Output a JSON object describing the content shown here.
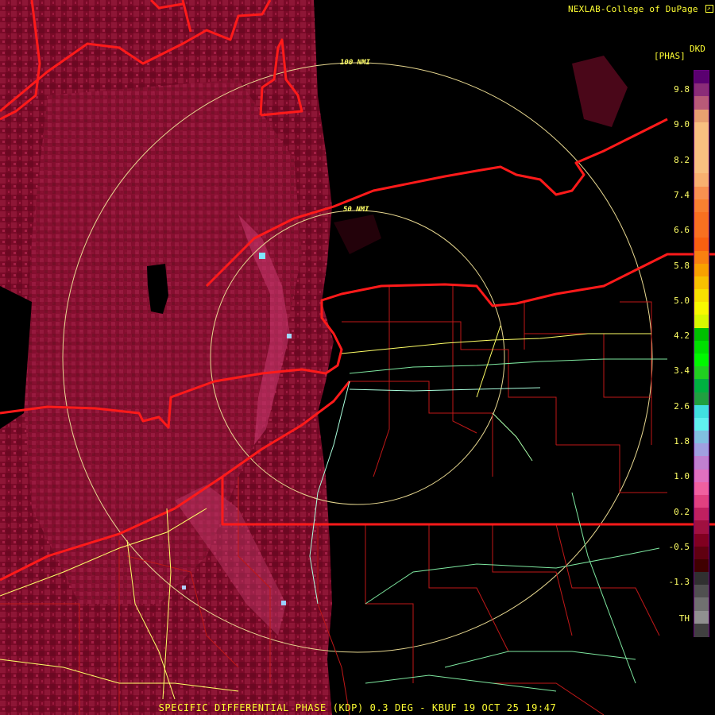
{
  "header": {
    "credit": "NEXLAB-College of DuPage",
    "credit_icon": "external-link-icon"
  },
  "legend": {
    "product_label": "DKD",
    "units_label": "[PHAS]",
    "ticks": [
      "9.8",
      "9.0",
      "8.2",
      "7.4",
      "6.6",
      "5.8",
      "5.0",
      "4.2",
      "3.4",
      "2.6",
      "1.8",
      "1.0",
      "0.2",
      "-0.5",
      "-1.3",
      "TH"
    ],
    "colors": [
      "#5a0070",
      "#8a2c78",
      "#b85a78",
      "#e8a070",
      "#f8c080",
      "#f8c080",
      "#f8c080",
      "#f8c080",
      "#f8b070",
      "#f89050",
      "#f88030",
      "#f87020",
      "#f87020",
      "#f86010",
      "#f88010",
      "#f8a000",
      "#f8c000",
      "#f8e000",
      "#f8f800",
      "#d8f800",
      "#00c000",
      "#00e000",
      "#00f800",
      "#20d020",
      "#00b040",
      "#20a040",
      "#40e0e0",
      "#60f0f0",
      "#80c0e0",
      "#a0a0e0",
      "#c080d0",
      "#e070c0",
      "#f060a0",
      "#e04080",
      "#c02060",
      "#a01040",
      "#800020",
      "#600010",
      "#400000",
      "#303030",
      "#505050",
      "#707070",
      "#909090",
      "#404040"
    ]
  },
  "map": {
    "ring_labels": [
      "100 NMI",
      "50 NMI"
    ]
  },
  "footer": {
    "caption": "SPECIFIC DIFFERENTIAL PHASE (KDP) 0.3 DEG - KBUF 19 OCT 25 19:47"
  }
}
